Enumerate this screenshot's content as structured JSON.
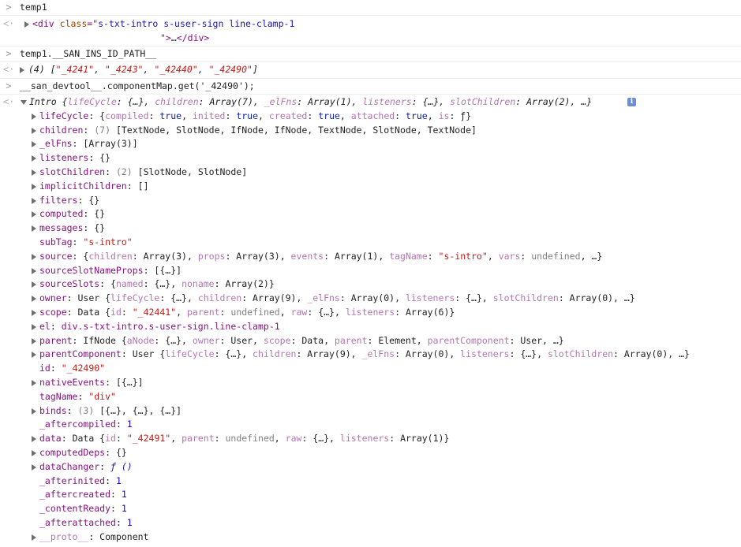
{
  "console": {
    "input1": "temp1",
    "output1": {
      "tag_open": "<div",
      "attr_name": "class",
      "attr_eq": "=\"",
      "attr_value": "s-txt-intro s-user-sign line-clamp-1",
      "attr_close": "\">",
      "ellipsis": "…",
      "tag_close": "</div>"
    },
    "input2": "temp1.__SAN_INS_ID_PATH__",
    "output2": {
      "count": "(4)",
      "open": "[",
      "items": [
        "\"_4241\"",
        "\"_4243\"",
        "\"_42440\"",
        "\"_42490\""
      ],
      "close": "]"
    },
    "input3": "__san_devtool__.componentMap.get('_42490');",
    "output3": {
      "summary": "Intro {lifeCycle: {…}, children: Array(7), _elFns: Array(1), listeners: {…}, slotChildren: Array(2), …}",
      "info_icon_glyph": "i",
      "props": [
        {
          "key": "lifeCycle",
          "sep": ": ",
          "value": "{compiled: true, inited: true, created: true, attached: true, is: ƒ}",
          "expandable": true
        },
        {
          "key": "children",
          "sep": ": ",
          "count": "(7) ",
          "value": "[TextNode, SlotNode, IfNode, IfNode, TextNode, SlotNode, TextNode]",
          "expandable": true
        },
        {
          "key": "_elFns",
          "sep": ": ",
          "value": "[Array(3)]",
          "expandable": true
        },
        {
          "key": "listeners",
          "sep": ": ",
          "value": "{}",
          "expandable": true
        },
        {
          "key": "slotChildren",
          "sep": ": ",
          "count": "(2) ",
          "value": "[SlotNode, SlotNode]",
          "expandable": true
        },
        {
          "key": "implicitChildren",
          "sep": ": ",
          "value": "[]",
          "expandable": true
        },
        {
          "key": "filters",
          "sep": ": ",
          "value": "{}",
          "expandable": true
        },
        {
          "key": "computed",
          "sep": ": ",
          "value": "{}",
          "expandable": true
        },
        {
          "key": "messages",
          "sep": ": ",
          "value": "{}",
          "expandable": true
        },
        {
          "key": "subTag",
          "sep": ": ",
          "value": "\"s-intro\"",
          "expandable": false,
          "kind": "str"
        },
        {
          "key": "source",
          "sep": ": ",
          "value": "{children: Array(3), props: Array(3), events: Array(1), tagName: \"s-intro\", vars: undefined, …}",
          "expandable": true
        },
        {
          "key": "sourceSlotNameProps",
          "sep": ": ",
          "value": "[{…}]",
          "expandable": true
        },
        {
          "key": "sourceSlots",
          "sep": ": ",
          "value": "{named: {…}, noname: Array(2)}",
          "expandable": true
        },
        {
          "key": "owner",
          "sep": ": ",
          "value": "User {lifeCycle: {…}, children: Array(9), _elFns: Array(0), listeners: {…}, slotChildren: Array(0), …}",
          "expandable": true
        },
        {
          "key": "scope",
          "sep": ": ",
          "value": "Data {id: \"_42441\", parent: undefined, raw: {…}, listeners: Array(6)}",
          "expandable": true
        },
        {
          "key": "el",
          "sep": ": ",
          "value": "div.s-txt-intro.s-user-sign.line-clamp-1",
          "expandable": true,
          "kind": "node"
        },
        {
          "key": "parent",
          "sep": ": ",
          "value": "IfNode {aNode: {…}, owner: User, scope: Data, parent: Element, parentComponent: User, …}",
          "expandable": true
        },
        {
          "key": "parentComponent",
          "sep": ": ",
          "value": "User {lifeCycle: {…}, children: Array(9), _elFns: Array(0), listeners: {…}, slotChildren: Array(0), …}",
          "expandable": true
        },
        {
          "key": "id",
          "sep": ": ",
          "value": "\"_42490\"",
          "expandable": false,
          "kind": "str"
        },
        {
          "key": "nativeEvents",
          "sep": ": ",
          "value": "[{…}]",
          "expandable": true
        },
        {
          "key": "tagName",
          "sep": ": ",
          "value": "\"div\"",
          "expandable": false,
          "kind": "str"
        },
        {
          "key": "binds",
          "sep": ": ",
          "count": "(3) ",
          "value": "[{…}, {…}, {…}]",
          "expandable": true
        },
        {
          "key": "_aftercompiled",
          "sep": ": ",
          "value": "1",
          "expandable": false,
          "kind": "num"
        },
        {
          "key": "data",
          "sep": ": ",
          "value": "Data {id: \"_42491\", parent: undefined, raw: {…}, listeners: Array(1)}",
          "expandable": true
        },
        {
          "key": "computedDeps",
          "sep": ": ",
          "value": "{}",
          "expandable": true
        },
        {
          "key": "dataChanger",
          "sep": ": ",
          "value": "ƒ ()",
          "expandable": true,
          "kind": "fn"
        },
        {
          "key": "_afterinited",
          "sep": ": ",
          "value": "1",
          "expandable": false,
          "kind": "num"
        },
        {
          "key": "_aftercreated",
          "sep": ": ",
          "value": "1",
          "expandable": false,
          "kind": "num"
        },
        {
          "key": "_contentReady",
          "sep": ": ",
          "value": "1",
          "expandable": false,
          "kind": "num"
        },
        {
          "key": "_afterattached",
          "sep": ": ",
          "value": "1",
          "expandable": false,
          "kind": "num"
        },
        {
          "key": "__proto__",
          "sep": ": ",
          "value": "Component",
          "expandable": true,
          "kind": "proto"
        }
      ]
    }
  }
}
